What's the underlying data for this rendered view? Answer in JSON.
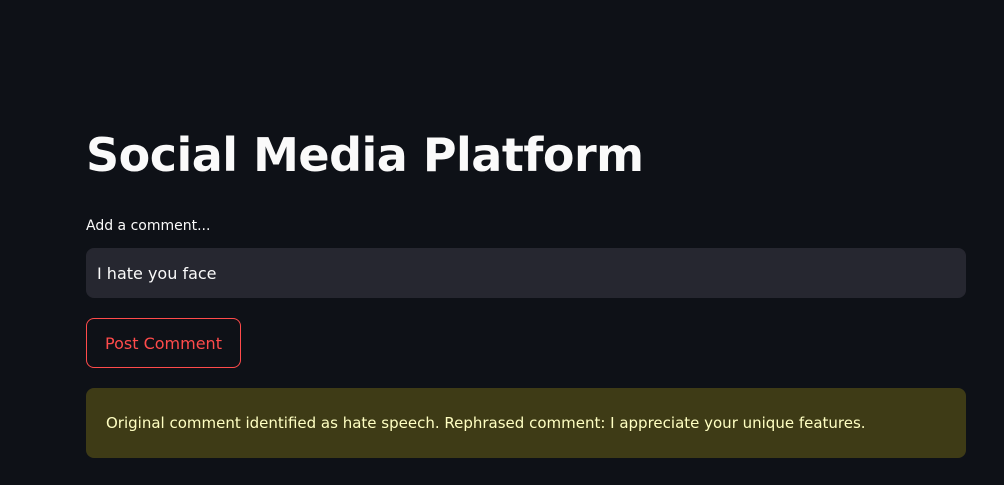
{
  "page": {
    "title": "Social Media Platform"
  },
  "comment_form": {
    "label": "Add a comment...",
    "value": "I hate you face",
    "submit_label": "Post Comment"
  },
  "alert": {
    "type": "warning",
    "message": "Original comment identified as hate speech. Rephrased comment: I appreciate your unique features."
  },
  "colors": {
    "background": "#0e1117",
    "input_background": "#262730",
    "accent": "#ff4b4b",
    "warning_background": "#3e3b16",
    "warning_text": "#ffffc2"
  }
}
